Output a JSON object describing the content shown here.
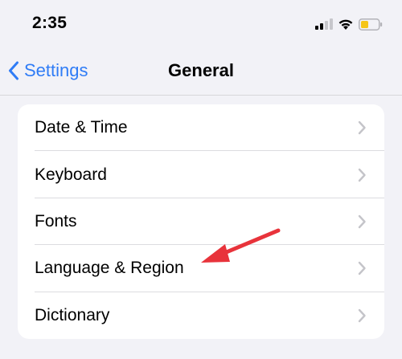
{
  "status_bar": {
    "time": "2:35",
    "icons": [
      "cellular-signal-icon",
      "wifi-icon",
      "battery-icon"
    ],
    "battery_color": "#f5c518"
  },
  "nav": {
    "back_label": "Settings",
    "title": "General"
  },
  "list": {
    "items": [
      {
        "label": "Date & Time"
      },
      {
        "label": "Keyboard"
      },
      {
        "label": "Fonts"
      },
      {
        "label": "Language & Region"
      },
      {
        "label": "Dictionary"
      }
    ]
  },
  "colors": {
    "accent": "#2f7cf6",
    "background": "#f2f2f7",
    "annotation_arrow": "#e8333b"
  }
}
